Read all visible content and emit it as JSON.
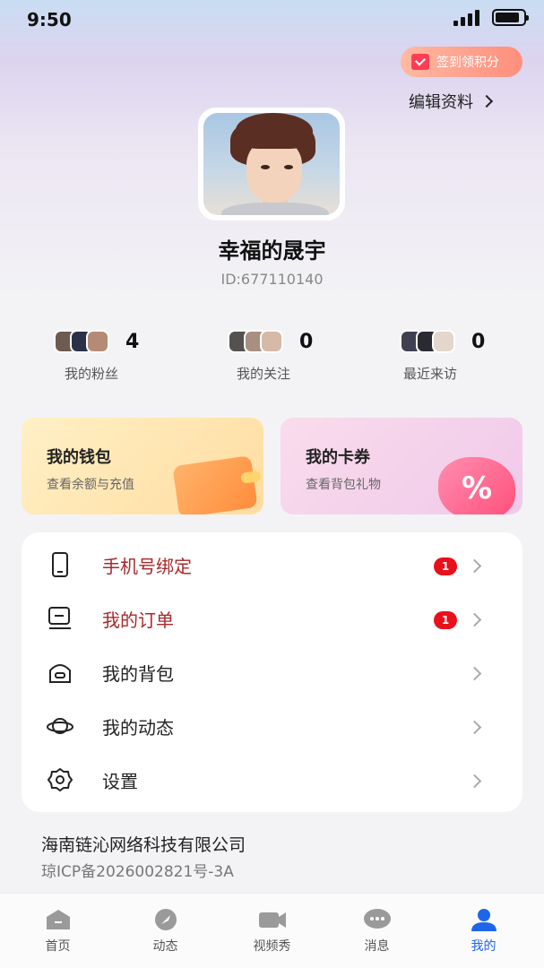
{
  "status_bar": {
    "time": "9:50"
  },
  "header": {
    "checkin_label": "签到领积分",
    "edit_profile_label": "编辑资料"
  },
  "profile": {
    "nickname": "幸福的晟宇",
    "user_id": "ID:677110140"
  },
  "stats": [
    {
      "count": "4",
      "label": "我的粉丝"
    },
    {
      "count": "0",
      "label": "我的关注"
    },
    {
      "count": "0",
      "label": "最近来访"
    }
  ],
  "cards": {
    "wallet": {
      "title": "我的钱包",
      "subtitle": "查看余额与充值"
    },
    "coupon": {
      "title": "我的卡券",
      "subtitle": "查看背包礼物",
      "art_text": "%"
    }
  },
  "menu": [
    {
      "label": "手机号绑定",
      "icon": "phone-icon",
      "badge": "1"
    },
    {
      "label": "我的订单",
      "icon": "order-icon",
      "badge": "1"
    },
    {
      "label": "我的背包",
      "icon": "backpack-icon"
    },
    {
      "label": "我的动态",
      "icon": "planet-icon"
    },
    {
      "label": "设置",
      "icon": "gear-icon"
    }
  ],
  "footer": {
    "company": "海南链沁网络科技有限公司",
    "icp": "琼ICP备2026002821号-3A"
  },
  "tabbar": [
    {
      "label": "首页",
      "icon": "home-icon"
    },
    {
      "label": "动态",
      "icon": "feed-icon"
    },
    {
      "label": "视频秀",
      "icon": "video-icon"
    },
    {
      "label": "消息",
      "icon": "message-icon"
    },
    {
      "label": "我的",
      "icon": "profile-icon",
      "active": true
    }
  ],
  "colors": {
    "accent_blue": "#1e66e8",
    "badge_red": "#e9101b",
    "menu_highlight": "#a8282a"
  }
}
